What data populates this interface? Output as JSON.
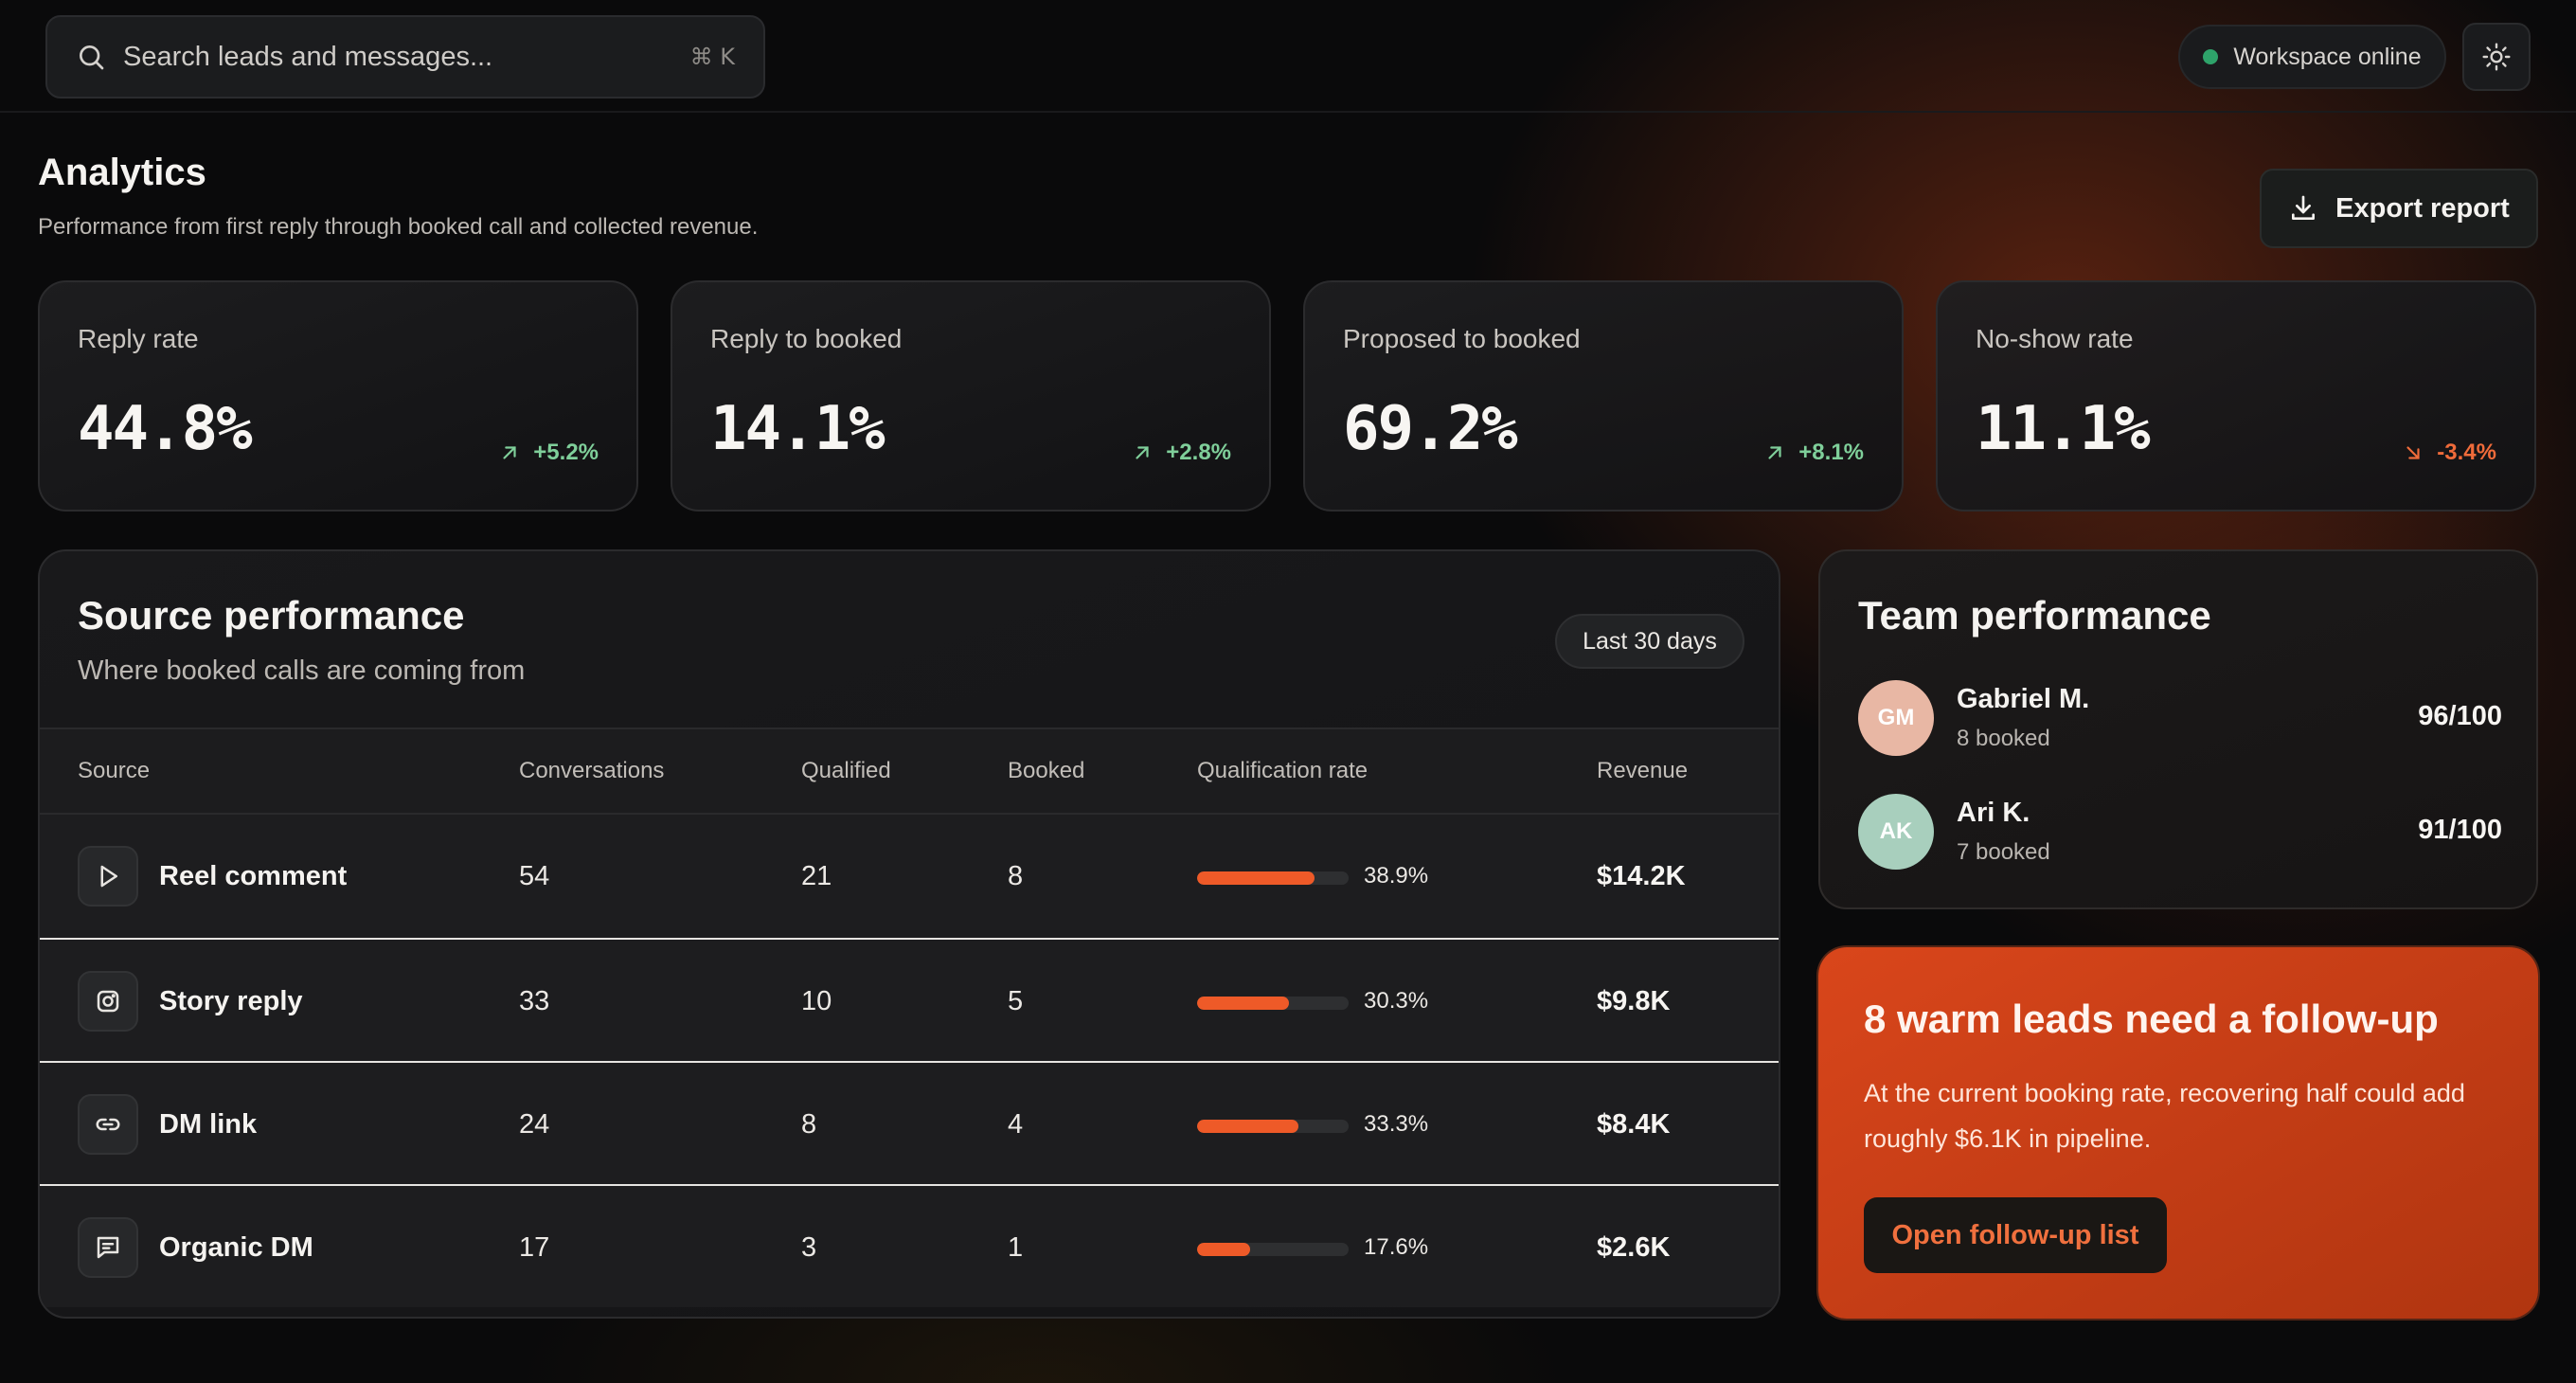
{
  "search": {
    "placeholder": "Search leads and messages...",
    "shortcut": "⌘ K"
  },
  "status": {
    "label": "Workspace online",
    "color": "#2ea36a"
  },
  "header": {
    "title": "Analytics",
    "subtitle": "Performance from first reply through booked call and collected revenue.",
    "export_label": "Export report"
  },
  "kpis": [
    {
      "label": "Reply rate",
      "value": "44.8%",
      "delta": "+5.2%",
      "trend": "up"
    },
    {
      "label": "Reply to booked",
      "value": "14.1%",
      "delta": "+2.8%",
      "trend": "up"
    },
    {
      "label": "Proposed to booked",
      "value": "69.2%",
      "delta": "+8.1%",
      "trend": "up"
    },
    {
      "label": "No-show rate",
      "value": "11.1%",
      "delta": "-3.4%",
      "trend": "down"
    }
  ],
  "source": {
    "title": "Source performance",
    "subtitle": "Where booked calls are coming from",
    "range": "Last 30 days",
    "columns": [
      "Source",
      "Conversations",
      "Qualified",
      "Booked",
      "Qualification rate",
      "Revenue"
    ],
    "rows": [
      {
        "icon": "play-icon",
        "name": "Reel comment",
        "conversations": "54",
        "qualified": "21",
        "booked": "8",
        "rate": "38.9%",
        "rate_value": 0.389,
        "revenue": "$14.2K"
      },
      {
        "icon": "instagram-icon",
        "name": "Story reply",
        "conversations": "33",
        "qualified": "10",
        "booked": "5",
        "rate": "30.3%",
        "rate_value": 0.303,
        "revenue": "$9.8K"
      },
      {
        "icon": "link-icon",
        "name": "DM link",
        "conversations": "24",
        "qualified": "8",
        "booked": "4",
        "rate": "33.3%",
        "rate_value": 0.333,
        "revenue": "$8.4K"
      },
      {
        "icon": "message-icon",
        "name": "Organic DM",
        "conversations": "17",
        "qualified": "3",
        "booked": "1",
        "rate": "17.6%",
        "rate_value": 0.176,
        "revenue": "$2.6K"
      }
    ]
  },
  "team": {
    "title": "Team performance",
    "members": [
      {
        "initials": "GM",
        "name": "Gabriel M.",
        "booked": "8 booked",
        "score": "96/100",
        "avatar_color": "#e8b7a4"
      },
      {
        "initials": "AK",
        "name": "Ari K.",
        "booked": "7 booked",
        "score": "91/100",
        "avatar_color": "#a8cfbd"
      }
    ]
  },
  "alert": {
    "title": "8 warm leads need a follow-up",
    "body": "At the current booking rate, recovering half could add roughly $6.1K in pipeline.",
    "button": "Open follow-up list"
  },
  "colors": {
    "accent": "#ee5a28",
    "positive": "#7fcf9a",
    "negative": "#f06b3a"
  }
}
